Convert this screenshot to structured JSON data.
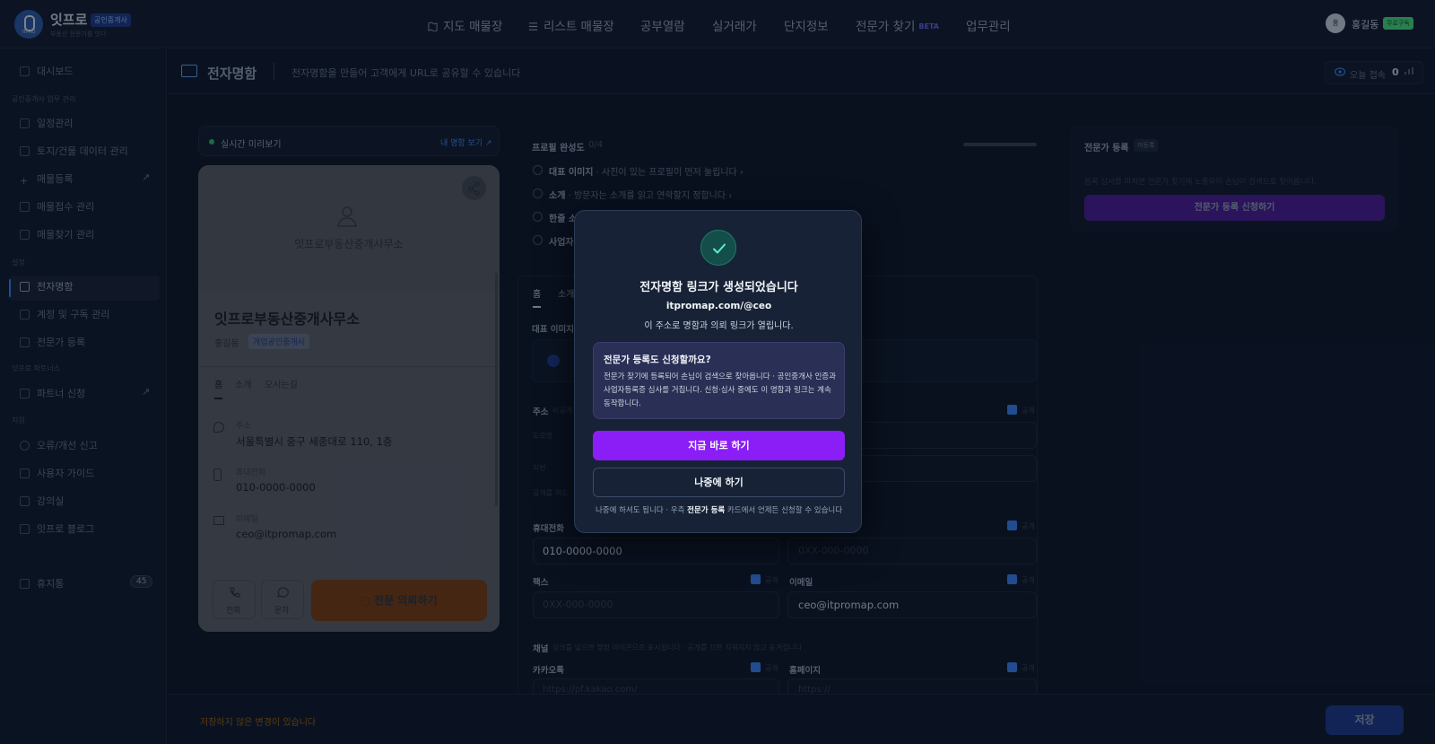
{
  "brand": {
    "title": "잇프로",
    "badge": "공인중개사",
    "tagline": "부동산 전문가를 잇다",
    "logo_text": "ITPRO"
  },
  "nav": [
    {
      "label": "지도 매물장",
      "icon": "map-icon"
    },
    {
      "label": "리스트 매물장",
      "icon": "list-icon"
    },
    {
      "label": "공부열람"
    },
    {
      "label": "실거래가"
    },
    {
      "label": "단지정보"
    },
    {
      "label": "전문가 찾기",
      "badge": "BETA"
    },
    {
      "label": "업무관리"
    }
  ],
  "user": {
    "avatar": "홍",
    "name": "홍길동",
    "plan": "무료구독"
  },
  "sidebar": {
    "dashboard": "대시보드",
    "section1": "공인중개사 업무 관리",
    "items1": [
      "일정관리",
      "토지/건물 데이터 관리",
      "매물등록",
      "매물접수 관리",
      "매물찾기 관리"
    ],
    "section2": "설정",
    "items2": [
      "전자명함",
      "계정 및 구독 관리",
      "전문가 등록"
    ],
    "section3": "잇프로 파트너스",
    "items3": [
      "파트너 신청"
    ],
    "section4": "지원",
    "items4": [
      "오류/개선 신고",
      "사용자 가이드",
      "강의실",
      "잇프로 블로그"
    ],
    "trash": "휴지통",
    "trash_count": "45"
  },
  "page": {
    "title": "전자명함",
    "desc": "전자명함을 만들어 고객에게 URL로 공유할 수 있습니다",
    "visit_label": "오늘 접속",
    "visit_count": "0"
  },
  "preview": {
    "label": "실시간 미리보기",
    "link": "내 명함 보기 ↗",
    "office": "잇프로부동산중개사무소",
    "rep": "홍길동",
    "badge": "개업공인중개사",
    "tabs": [
      "홈",
      "소개",
      "오시는길"
    ],
    "address_label": "주소",
    "address": "서울특별시 중구 세종대로 110, 1층",
    "phone_label": "휴대전화",
    "phone": "010-0000-0000",
    "email_label": "이메일",
    "email": "ceo@itpromap.com",
    "call": "전화",
    "sms": "문자",
    "cta": "전문 의뢰하기"
  },
  "profile": {
    "title": "프로필 완성도",
    "count": "0/4",
    "checks": [
      {
        "bold": "대표 이미지",
        "rest": " · 사진이 있는 프로필이 먼저 눌립니다"
      },
      {
        "bold": "소개",
        "rest": " · 방문자는 소개를 읽고 연락할지 정합니다"
      },
      {
        "bold": "한줄 소",
        "rest": ""
      },
      {
        "bold": "사업자",
        "rest": ""
      }
    ]
  },
  "form": {
    "tabs": [
      "홈",
      "소개"
    ],
    "rep_image": "대표 이미지",
    "address": "주소",
    "address_sub": "비공개",
    "road": "도로명",
    "lot": "지번",
    "public_note": "공개를 꺼도",
    "mobile": "휴대전화",
    "mobile_value": "010-0000-0000",
    "tel_ph": "0XX-000-0000",
    "fax": "팩스",
    "fax_ph": "0XX-000-0000",
    "email": "이메일",
    "email_value": "ceo@itpromap.com",
    "public": "공개",
    "channel": "채널",
    "channel_desc": "링크를 넣으면 명함 아이콘으로 표시됩니다 · 공개를 끄면 지워지지 않고 숨겨집니다",
    "kakao": "카카오톡",
    "kakao_ph": "https://pf.kakao.com/",
    "homepage": "홈페이지",
    "homepage_ph": "https://"
  },
  "expert": {
    "title": "전문가 등록",
    "badge": "미등록",
    "desc": "등록 심사를 마치면 전문가 찾기에 노출되어 손님이 검색으로 찾아옵니다.",
    "button": "전문가 등록 신청하기"
  },
  "footer": {
    "unsaved": "저장하지 않은 변경이 있습니다",
    "save": "저장"
  },
  "modal": {
    "title": "전자명함 링크가 생성되었습니다",
    "url": "itpromap.com/@ceo",
    "desc": "이 주소로 명함과 의뢰 링크가 열립니다.",
    "box_title": "전문가 등록도 신청할까요?",
    "box_text": "전문가 찾기에 등록되어 손님이 검색으로 찾아옵니다 · 공인중개사 인증과 사업자등록증 심사를 거칩니다. 신청·심사 중에도 이 명함과 링크는 계속 동작합니다.",
    "primary": "지금 바로 하기",
    "secondary": "나중에 하기",
    "note_pre": "나중에 하셔도 됩니다 · 우측 ",
    "note_bold": "전문가 등록",
    "note_post": " 카드에서 언제든 신청할 수 있습니다"
  },
  "colors": {
    "accent": "#8b1ef7",
    "brand": "#2b5aa8",
    "success": "#22c55e"
  }
}
